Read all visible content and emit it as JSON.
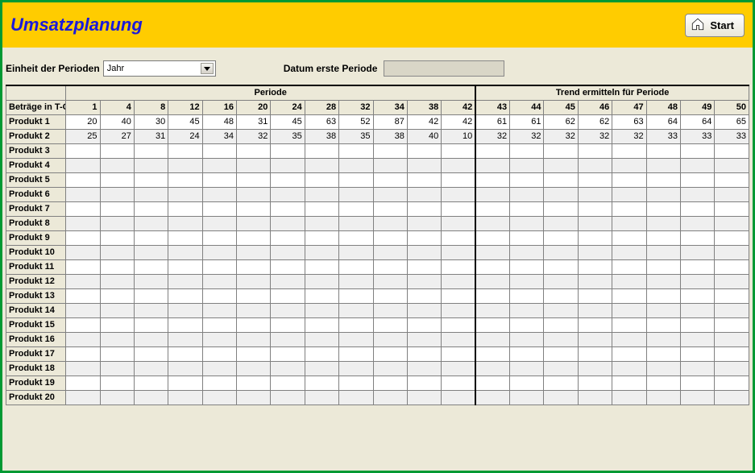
{
  "header": {
    "title": "Umsatzplanung",
    "start_label": "Start"
  },
  "controls": {
    "period_unit_label": "Einheit der Perioden",
    "period_unit_value": "Jahr",
    "first_period_label": "Datum erste Periode",
    "first_period_value": ""
  },
  "table": {
    "group_headers": {
      "periode": "Periode",
      "trend": "Trend ermitteln für Periode"
    },
    "row_header": "Beträge in T-CHF",
    "periode_cols": [
      "1",
      "4",
      "8",
      "12",
      "16",
      "20",
      "24",
      "28",
      "32",
      "34",
      "38",
      "42"
    ],
    "trend_cols": [
      "43",
      "44",
      "45",
      "46",
      "47",
      "48",
      "49",
      "50"
    ],
    "rows": [
      {
        "label": "Produkt 1",
        "periode": [
          "20",
          "40",
          "30",
          "45",
          "48",
          "31",
          "45",
          "63",
          "52",
          "87",
          "42",
          "42"
        ],
        "trend": [
          "61",
          "61",
          "62",
          "62",
          "63",
          "64",
          "64",
          "65"
        ]
      },
      {
        "label": "Produkt 2",
        "periode": [
          "25",
          "27",
          "31",
          "24",
          "34",
          "32",
          "35",
          "38",
          "35",
          "38",
          "40",
          "10"
        ],
        "trend": [
          "32",
          "32",
          "32",
          "32",
          "32",
          "33",
          "33",
          "33"
        ]
      },
      {
        "label": "Produkt 3",
        "periode": [
          "",
          "",
          "",
          "",
          "",
          "",
          "",
          "",
          "",
          "",
          "",
          ""
        ],
        "trend": [
          "",
          "",
          "",
          "",
          "",
          "",
          "",
          ""
        ]
      },
      {
        "label": "Produkt 4",
        "periode": [
          "",
          "",
          "",
          "",
          "",
          "",
          "",
          "",
          "",
          "",
          "",
          ""
        ],
        "trend": [
          "",
          "",
          "",
          "",
          "",
          "",
          "",
          ""
        ]
      },
      {
        "label": "Produkt 5",
        "periode": [
          "",
          "",
          "",
          "",
          "",
          "",
          "",
          "",
          "",
          "",
          "",
          ""
        ],
        "trend": [
          "",
          "",
          "",
          "",
          "",
          "",
          "",
          ""
        ]
      },
      {
        "label": "Produkt 6",
        "periode": [
          "",
          "",
          "",
          "",
          "",
          "",
          "",
          "",
          "",
          "",
          "",
          ""
        ],
        "trend": [
          "",
          "",
          "",
          "",
          "",
          "",
          "",
          ""
        ]
      },
      {
        "label": "Produkt 7",
        "periode": [
          "",
          "",
          "",
          "",
          "",
          "",
          "",
          "",
          "",
          "",
          "",
          ""
        ],
        "trend": [
          "",
          "",
          "",
          "",
          "",
          "",
          "",
          ""
        ]
      },
      {
        "label": "Produkt 8",
        "periode": [
          "",
          "",
          "",
          "",
          "",
          "",
          "",
          "",
          "",
          "",
          "",
          ""
        ],
        "trend": [
          "",
          "",
          "",
          "",
          "",
          "",
          "",
          ""
        ]
      },
      {
        "label": "Produkt 9",
        "periode": [
          "",
          "",
          "",
          "",
          "",
          "",
          "",
          "",
          "",
          "",
          "",
          ""
        ],
        "trend": [
          "",
          "",
          "",
          "",
          "",
          "",
          "",
          ""
        ]
      },
      {
        "label": "Produkt 10",
        "periode": [
          "",
          "",
          "",
          "",
          "",
          "",
          "",
          "",
          "",
          "",
          "",
          ""
        ],
        "trend": [
          "",
          "",
          "",
          "",
          "",
          "",
          "",
          ""
        ]
      },
      {
        "label": "Produkt 11",
        "periode": [
          "",
          "",
          "",
          "",
          "",
          "",
          "",
          "",
          "",
          "",
          "",
          ""
        ],
        "trend": [
          "",
          "",
          "",
          "",
          "",
          "",
          "",
          ""
        ]
      },
      {
        "label": "Produkt 12",
        "periode": [
          "",
          "",
          "",
          "",
          "",
          "",
          "",
          "",
          "",
          "",
          "",
          ""
        ],
        "trend": [
          "",
          "",
          "",
          "",
          "",
          "",
          "",
          ""
        ]
      },
      {
        "label": "Produkt 13",
        "periode": [
          "",
          "",
          "",
          "",
          "",
          "",
          "",
          "",
          "",
          "",
          "",
          ""
        ],
        "trend": [
          "",
          "",
          "",
          "",
          "",
          "",
          "",
          ""
        ]
      },
      {
        "label": "Produkt 14",
        "periode": [
          "",
          "",
          "",
          "",
          "",
          "",
          "",
          "",
          "",
          "",
          "",
          ""
        ],
        "trend": [
          "",
          "",
          "",
          "",
          "",
          "",
          "",
          ""
        ]
      },
      {
        "label": "Produkt 15",
        "periode": [
          "",
          "",
          "",
          "",
          "",
          "",
          "",
          "",
          "",
          "",
          "",
          ""
        ],
        "trend": [
          "",
          "",
          "",
          "",
          "",
          "",
          "",
          ""
        ]
      },
      {
        "label": "Produkt 16",
        "periode": [
          "",
          "",
          "",
          "",
          "",
          "",
          "",
          "",
          "",
          "",
          "",
          ""
        ],
        "trend": [
          "",
          "",
          "",
          "",
          "",
          "",
          "",
          ""
        ]
      },
      {
        "label": "Produkt 17",
        "periode": [
          "",
          "",
          "",
          "",
          "",
          "",
          "",
          "",
          "",
          "",
          "",
          ""
        ],
        "trend": [
          "",
          "",
          "",
          "",
          "",
          "",
          "",
          ""
        ]
      },
      {
        "label": "Produkt 18",
        "periode": [
          "",
          "",
          "",
          "",
          "",
          "",
          "",
          "",
          "",
          "",
          "",
          ""
        ],
        "trend": [
          "",
          "",
          "",
          "",
          "",
          "",
          "",
          ""
        ]
      },
      {
        "label": "Produkt 19",
        "periode": [
          "",
          "",
          "",
          "",
          "",
          "",
          "",
          "",
          "",
          "",
          "",
          ""
        ],
        "trend": [
          "",
          "",
          "",
          "",
          "",
          "",
          "",
          ""
        ]
      },
      {
        "label": "Produkt 20",
        "periode": [
          "",
          "",
          "",
          "",
          "",
          "",
          "",
          "",
          "",
          "",
          "",
          ""
        ],
        "trend": [
          "",
          "",
          "",
          "",
          "",
          "",
          "",
          ""
        ]
      }
    ]
  },
  "chart_data": {
    "type": "table",
    "title": "Umsatzplanung",
    "row_header": "Beträge in T-CHF",
    "columns_periode": [
      1,
      4,
      8,
      12,
      16,
      20,
      24,
      28,
      32,
      34,
      38,
      42
    ],
    "columns_trend": [
      43,
      44,
      45,
      46,
      47,
      48,
      49,
      50
    ],
    "series": [
      {
        "name": "Produkt 1",
        "periode": [
          20,
          40,
          30,
          45,
          48,
          31,
          45,
          63,
          52,
          87,
          42,
          42
        ],
        "trend": [
          61,
          61,
          62,
          62,
          63,
          64,
          64,
          65
        ]
      },
      {
        "name": "Produkt 2",
        "periode": [
          25,
          27,
          31,
          24,
          34,
          32,
          35,
          38,
          35,
          38,
          40,
          10
        ],
        "trend": [
          32,
          32,
          32,
          32,
          32,
          33,
          33,
          33
        ]
      }
    ]
  }
}
